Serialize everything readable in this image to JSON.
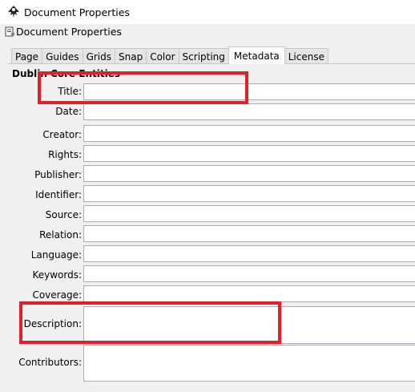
{
  "window": {
    "title": "Document Properties",
    "icon": "inkscape-logo-icon"
  },
  "panel": {
    "title": "Document Properties",
    "icon": "document-properties-icon"
  },
  "tabs": [
    {
      "label": "Page"
    },
    {
      "label": "Guides"
    },
    {
      "label": "Grids"
    },
    {
      "label": "Snap"
    },
    {
      "label": "Color"
    },
    {
      "label": "Scripting"
    },
    {
      "label": "Metadata",
      "active": true
    },
    {
      "label": "License"
    }
  ],
  "section": {
    "title": "Dublin Core Entities"
  },
  "fields": [
    {
      "label": "Title:",
      "value": ""
    },
    {
      "label": "Date:",
      "value": ""
    },
    {
      "label": "Creator:",
      "value": ""
    },
    {
      "label": "Rights:",
      "value": ""
    },
    {
      "label": "Publisher:",
      "value": ""
    },
    {
      "label": "Identifier:",
      "value": ""
    },
    {
      "label": "Source:",
      "value": ""
    },
    {
      "label": "Relation:",
      "value": ""
    },
    {
      "label": "Language:",
      "value": ""
    },
    {
      "label": "Keywords:",
      "value": ""
    },
    {
      "label": "Coverage:",
      "value": ""
    },
    {
      "label": "Description:",
      "value": ""
    },
    {
      "label": "Contributors:",
      "value": ""
    }
  ],
  "colors": {
    "highlight": "#e0202a"
  }
}
